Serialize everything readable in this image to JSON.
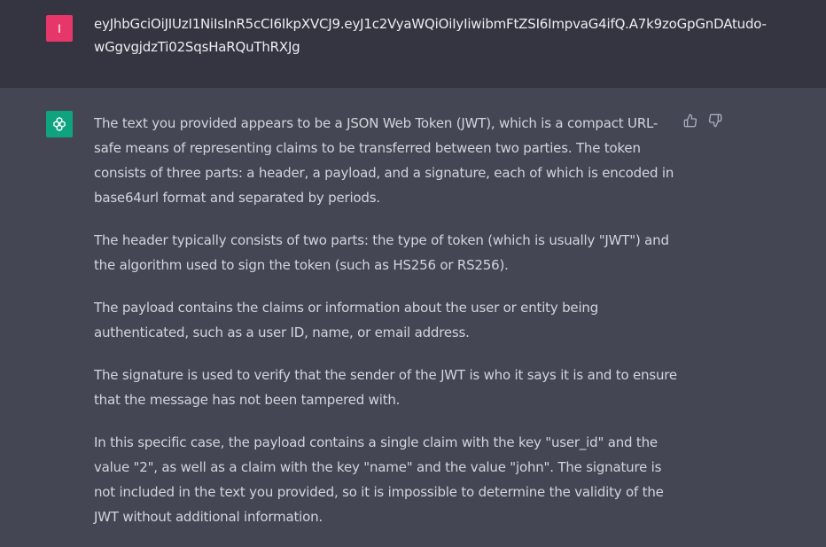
{
  "user_message": {
    "avatar_letter": "I",
    "text": "eyJhbGciOiJIUzI1NiIsInR5cCI6IkpXVCJ9.eyJ1c2VyaWQiOiIyIiwibmFtZSI6ImpvaG4ifQ.A7k9zoGpGnDAtudo-wGgvgjdzTi02SqsHaRQuThRXJg"
  },
  "assistant_message": {
    "avatar_icon": "openai-logo-icon",
    "paragraphs": [
      "The text you provided appears to be a JSON Web Token (JWT), which is a compact URL-safe means of representing claims to be transferred between two parties. The token consists of three parts: a header, a payload, and a signature, each of which is encoded in base64url format and separated by periods.",
      "The header typically consists of two parts: the type of token (which is usually \"JWT\") and the algorithm used to sign the token (such as HS256 or RS256).",
      "The payload contains the claims or information about the user or entity being authenticated, such as a user ID, name, or email address.",
      "The signature is used to verify that the sender of the JWT is who it says it is and to ensure that the message has not been tampered with.",
      "In this specific case, the payload contains a single claim with the key \"user_id\" and the value \"2\", as well as a claim with the key \"name\" and the value \"john\". The signature is not included in the text you provided, so it is impossible to determine the validity of the JWT without additional information."
    ],
    "feedback_icons": [
      "thumbs-up-icon",
      "thumbs-down-icon"
    ]
  },
  "colors": {
    "user_bg": "#343541",
    "assistant_bg": "#444654",
    "user_avatar": "#e6366a",
    "assistant_avatar": "#10a37f",
    "text": "#d1d5db"
  }
}
